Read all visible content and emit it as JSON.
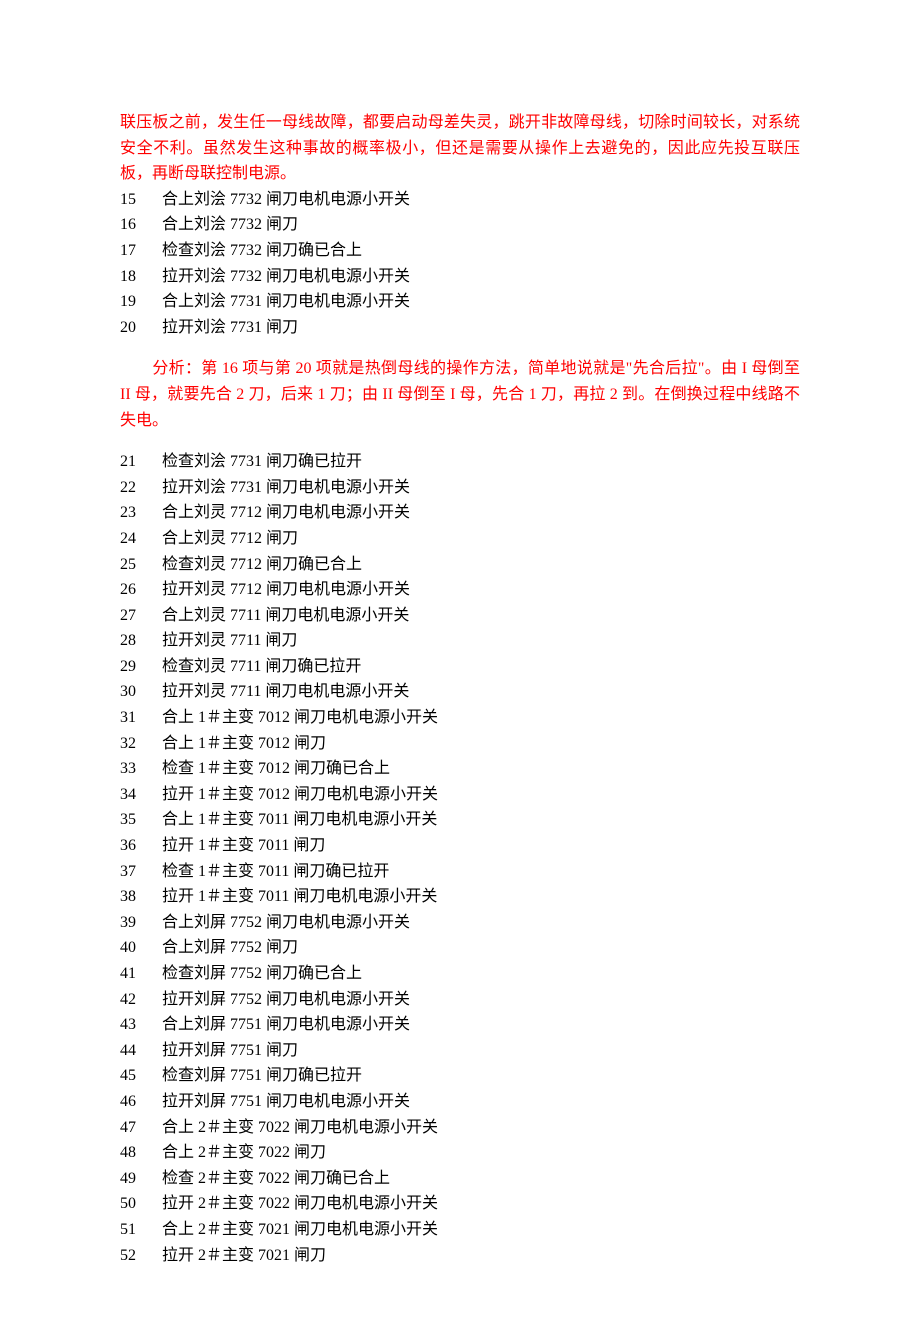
{
  "intro_red": "联压板之前，发生任一母线故障，都要启动母差失灵，跳开非故障母线，切除时间较长，对系统安全不利。虽然发生这种事故的概率极小，但还是需要从操作上去避免的，因此应先投互联压板，再断母联控制电源。",
  "items_a": [
    {
      "num": "15",
      "text": "合上刘浍 7732 闸刀电机电源小开关"
    },
    {
      "num": "16",
      "text": "合上刘浍 7732 闸刀"
    },
    {
      "num": "17",
      "text": "检查刘浍 7732 闸刀确已合上"
    },
    {
      "num": "18",
      "text": "拉开刘浍 7732 闸刀电机电源小开关"
    },
    {
      "num": "19",
      "text": "合上刘浍 7731 闸刀电机电源小开关"
    },
    {
      "num": "20",
      "text": "拉开刘浍 7731 闸刀"
    }
  ],
  "analysis_red": "分析：第 16 项与第 20 项就是热倒母线的操作方法，简单地说就是\"先合后拉\"。由 I 母倒至 II 母，就要先合 2 刀，后来 1 刀；由 II 母倒至 I 母，先合 1 刀，再拉 2 到。在倒换过程中线路不失电。",
  "items_b": [
    {
      "num": "21",
      "text": "检查刘浍 7731 闸刀确已拉开"
    },
    {
      "num": "22",
      "text": "拉开刘浍 7731 闸刀电机电源小开关"
    },
    {
      "num": "23",
      "text": "合上刘灵 7712 闸刀电机电源小开关"
    },
    {
      "num": "24",
      "text": "合上刘灵 7712 闸刀"
    },
    {
      "num": "25",
      "text": "检查刘灵 7712 闸刀确已合上"
    },
    {
      "num": "26",
      "text": "拉开刘灵 7712 闸刀电机电源小开关"
    },
    {
      "num": "27",
      "text": "合上刘灵 7711 闸刀电机电源小开关"
    },
    {
      "num": "28",
      "text": "拉开刘灵 7711 闸刀"
    },
    {
      "num": "29",
      "text": "检查刘灵 7711 闸刀确已拉开"
    },
    {
      "num": "30",
      "text": "拉开刘灵 7711 闸刀电机电源小开关"
    },
    {
      "num": "31",
      "text": "合上 1＃主变 7012 闸刀电机电源小开关"
    },
    {
      "num": "32",
      "text": "合上 1＃主变 7012 闸刀"
    },
    {
      "num": "33",
      "text": "检查 1＃主变 7012 闸刀确已合上"
    },
    {
      "num": "34",
      "text": "拉开 1＃主变 7012 闸刀电机电源小开关"
    },
    {
      "num": "35",
      "text": "合上 1＃主变 7011 闸刀电机电源小开关"
    },
    {
      "num": "36",
      "text": "拉开 1＃主变 7011 闸刀"
    },
    {
      "num": "37",
      "text": "检查 1＃主变 7011 闸刀确已拉开"
    },
    {
      "num": "38",
      "text": "拉开 1＃主变 7011 闸刀电机电源小开关"
    },
    {
      "num": "39",
      "text": "合上刘屏 7752 闸刀电机电源小开关"
    },
    {
      "num": "40",
      "text": "合上刘屏 7752 闸刀"
    },
    {
      "num": "41",
      "text": "检查刘屏 7752 闸刀确已合上"
    },
    {
      "num": "42",
      "text": "拉开刘屏 7752 闸刀电机电源小开关"
    },
    {
      "num": "43",
      "text": "合上刘屏 7751 闸刀电机电源小开关"
    },
    {
      "num": "44",
      "text": "拉开刘屏 7751 闸刀"
    },
    {
      "num": "45",
      "text": "检查刘屏 7751 闸刀确已拉开"
    },
    {
      "num": "46",
      "text": "拉开刘屏 7751 闸刀电机电源小开关"
    },
    {
      "num": "47",
      "text": "合上 2＃主变 7022 闸刀电机电源小开关"
    },
    {
      "num": "48",
      "text": "合上 2＃主变 7022 闸刀"
    },
    {
      "num": "49",
      "text": "检查 2＃主变 7022 闸刀确已合上"
    },
    {
      "num": "50",
      "text": "拉开 2＃主变 7022 闸刀电机电源小开关"
    },
    {
      "num": "51",
      "text": "合上 2＃主变 7021 闸刀电机电源小开关"
    },
    {
      "num": "52",
      "text": "拉开 2＃主变 7021 闸刀"
    }
  ]
}
